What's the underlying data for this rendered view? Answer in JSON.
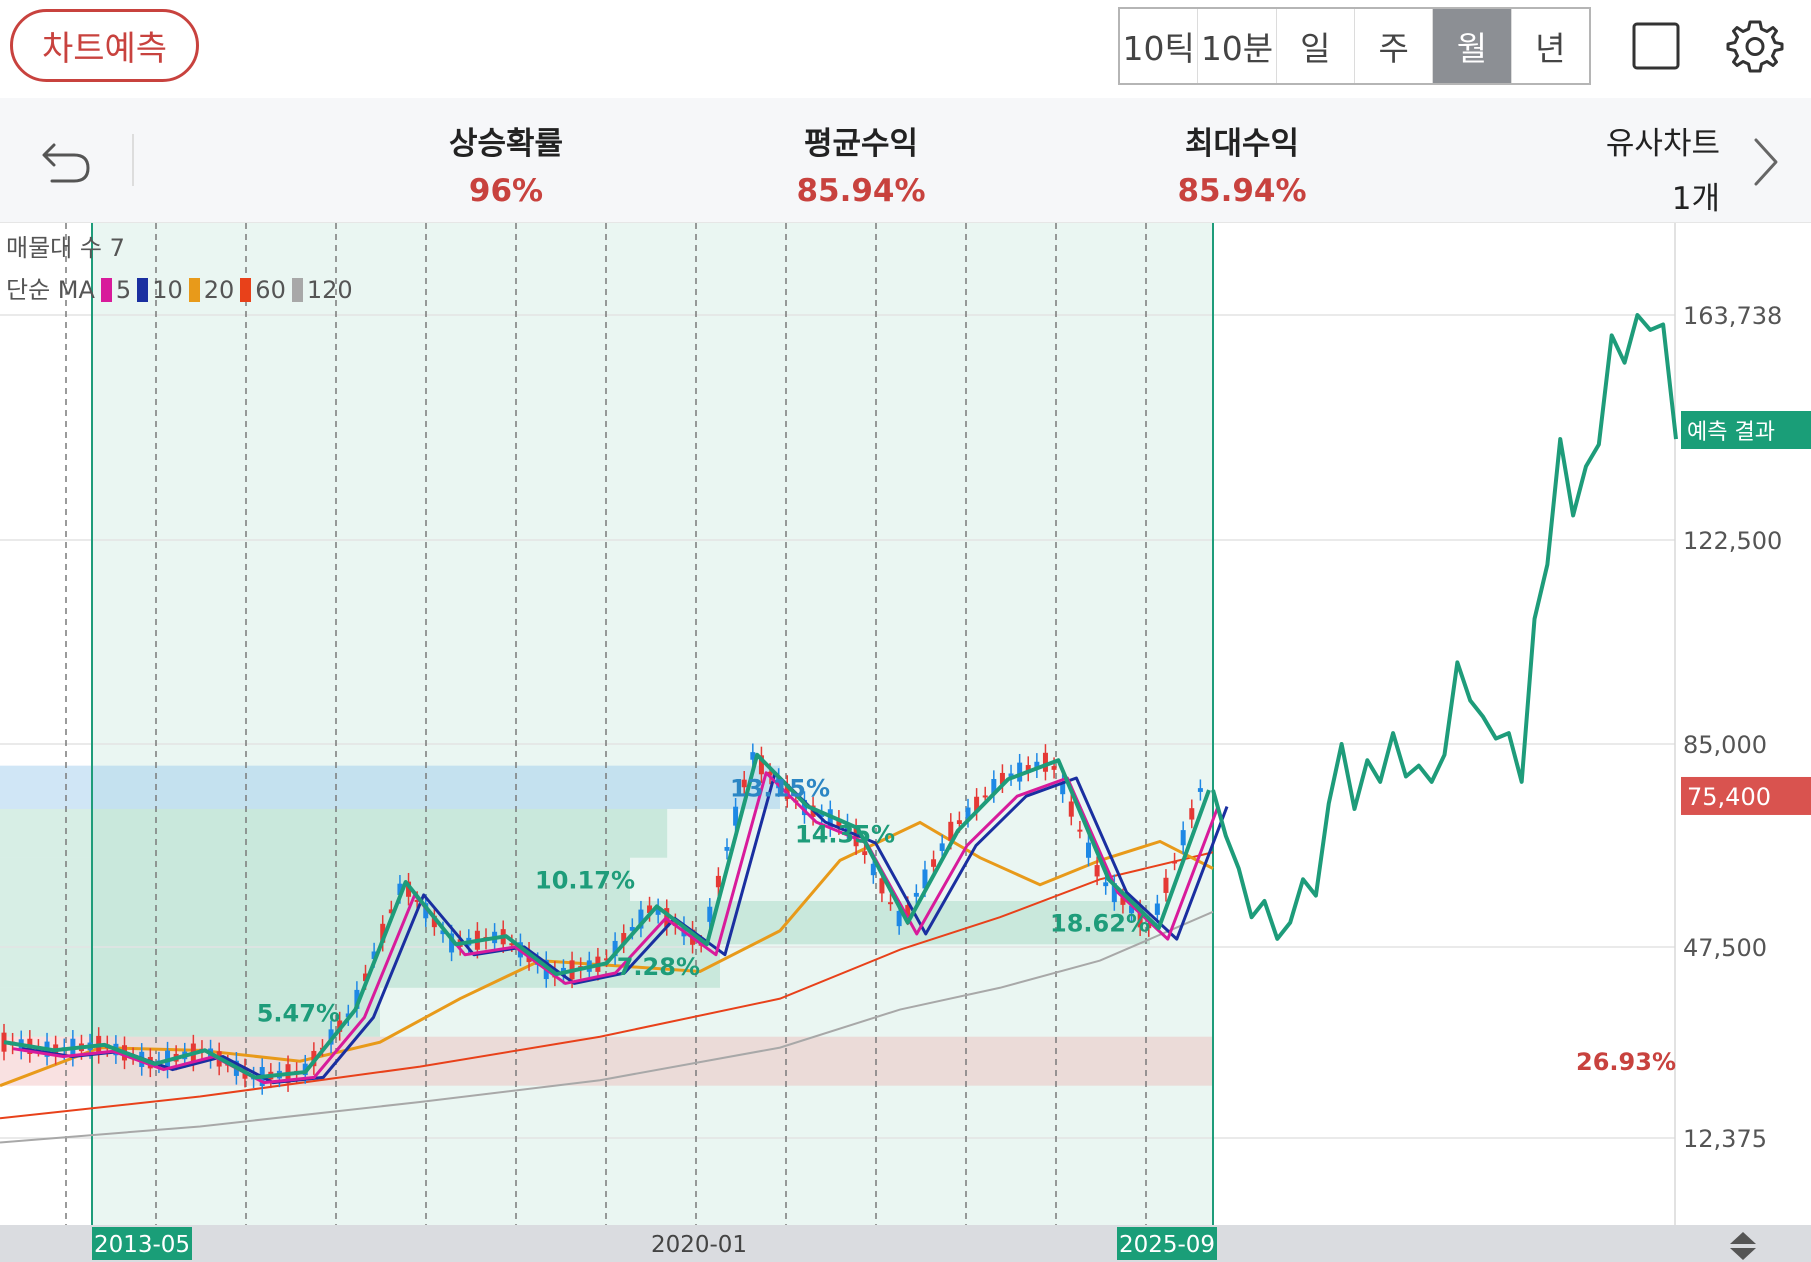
{
  "header": {
    "predict_button": "차트예측",
    "periods": [
      "10틱",
      "10분",
      "일",
      "주",
      "월",
      "년"
    ],
    "active_period": "월"
  },
  "stats": {
    "rise_prob_label": "상승확률",
    "rise_prob_value": "96%",
    "avg_return_label": "평균수익",
    "avg_return_value": "85.94%",
    "max_return_label": "최대수익",
    "max_return_value": "85.94%",
    "similar_label": "유사차트",
    "similar_count": "1개"
  },
  "colors": {
    "accent_red": "#c8423e",
    "pattern_green": "#1e9c7a",
    "current_price_bg": "#d9534f",
    "forecast_badge_bg": "#1a9e78",
    "up_candle": "#e53935",
    "down_candle": "#1e88e5",
    "ma5": "#d81b9b",
    "ma10": "#1a2fa0",
    "ma20": "#e89a1a",
    "ma60": "#e8411a",
    "ma120": "#a8a8a8"
  },
  "chart_data": {
    "type": "line",
    "legend": {
      "volume_profile": "매물대 수 7",
      "ma_prefix": "단순 MA",
      "ma_periods": [
        {
          "label": "5",
          "color": "#d81b9b"
        },
        {
          "label": "10",
          "color": "#1a2fa0"
        },
        {
          "label": "20",
          "color": "#e89a1a"
        },
        {
          "label": "60",
          "color": "#e8411a"
        },
        {
          "label": "120",
          "color": "#a8a8a8"
        }
      ]
    },
    "y_ticks": [
      12375,
      47500,
      85000,
      122500,
      163738
    ],
    "y_tick_labels": [
      "12,375",
      "47,500",
      "85,000",
      "122,500",
      "163,738"
    ],
    "y_range": [
      0,
      180000
    ],
    "current_price": 75400,
    "current_price_label": "75,400",
    "forecast_badge": "예측 결과",
    "x_labels": [
      {
        "label": "2013-05",
        "highlight": true
      },
      {
        "label": "2020-01",
        "highlight": false
      },
      {
        "label": "2025-09",
        "highlight": true
      }
    ],
    "volume_profile_bands": [
      {
        "from": 73000,
        "to": 81000,
        "pct": "13.15%"
      },
      {
        "from": 64000,
        "to": 73000,
        "pct": "14.35%"
      },
      {
        "from": 56000,
        "to": 64000,
        "pct": "10.17%"
      },
      {
        "from": 48000,
        "to": 56000,
        "pct": "18.62%"
      },
      {
        "from": 40000,
        "to": 48000,
        "pct": "7.28%"
      },
      {
        "from": 31000,
        "to": 40000,
        "pct": "5.47%"
      },
      {
        "from": 22000,
        "to": 31000,
        "pct": "26.93%"
      }
    ],
    "zigzag_pattern": [
      30000,
      28500,
      29500,
      26000,
      28500,
      23500,
      24500,
      36000,
      59500,
      48000,
      49500,
      42500,
      44500,
      55000,
      48000,
      83000,
      73500,
      69500,
      52000,
      69000,
      78500,
      82000,
      60000,
      51000,
      76500
    ],
    "forecast": [
      76500,
      68000,
      62000,
      53000,
      56000,
      49000,
      52000,
      60000,
      57000,
      74000,
      85000,
      73000,
      82000,
      78000,
      87000,
      79000,
      81000,
      78000,
      83000,
      100000,
      93000,
      90000,
      86000,
      87000,
      78000,
      108000,
      118000,
      141000,
      127000,
      136000,
      140000,
      160000,
      155000,
      163738,
      161000,
      162000,
      141000
    ]
  }
}
